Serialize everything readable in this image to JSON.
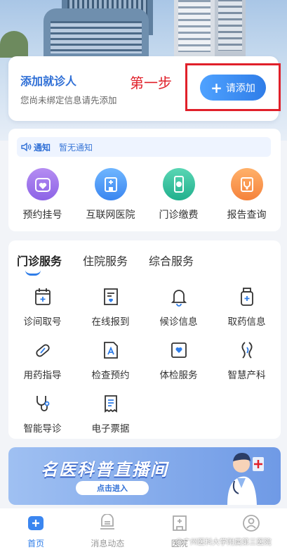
{
  "patient_card": {
    "title": "添加就诊人",
    "subtitle": "您尚未绑定信息请先添加",
    "step_label": "第一步",
    "add_button_label": "请添加"
  },
  "notice": {
    "tag": "通知",
    "text": "暂无通知"
  },
  "quick_items": [
    {
      "label": "预约挂号",
      "icon": "heart-calendar-icon"
    },
    {
      "label": "互联网医院",
      "icon": "hospital-building-icon"
    },
    {
      "label": "门诊缴费",
      "icon": "payment-phone-icon"
    },
    {
      "label": "报告查询",
      "icon": "stethoscope-clipboard-icon"
    }
  ],
  "service_tabs": [
    "门诊服务",
    "住院服务",
    "综合服务"
  ],
  "services": [
    {
      "label": "诊间取号",
      "icon": "calendar-plus-icon"
    },
    {
      "label": "在线报到",
      "icon": "check-in-document-icon"
    },
    {
      "label": "候诊信息",
      "icon": "bell-icon"
    },
    {
      "label": "取药信息",
      "icon": "medicine-bottle-icon"
    },
    {
      "label": "用药指导",
      "icon": "pill-icon"
    },
    {
      "label": "检查预约",
      "icon": "exam-document-icon"
    },
    {
      "label": "体检服务",
      "icon": "heart-frame-icon"
    },
    {
      "label": "智慧产科",
      "icon": "pregnancy-icon"
    },
    {
      "label": "智能导诊",
      "icon": "stethoscope-icon"
    },
    {
      "label": "电子票据",
      "icon": "receipt-icon"
    }
  ],
  "banner": {
    "title": "名医科普直播间",
    "button_label": "点击进入"
  },
  "tabbar": [
    {
      "label": "首页",
      "icon": "home-icon",
      "active": true
    },
    {
      "label": "消息动态",
      "icon": "message-icon",
      "active": false
    },
    {
      "label": "医院",
      "icon": "hospital-icon",
      "active": false
    },
    {
      "label": "",
      "icon": "user-icon",
      "active": false
    }
  ],
  "watermark": "@广州医科大学附属第三医院",
  "colors": {
    "accent": "#2f7de8",
    "highlight": "#e0202a"
  }
}
